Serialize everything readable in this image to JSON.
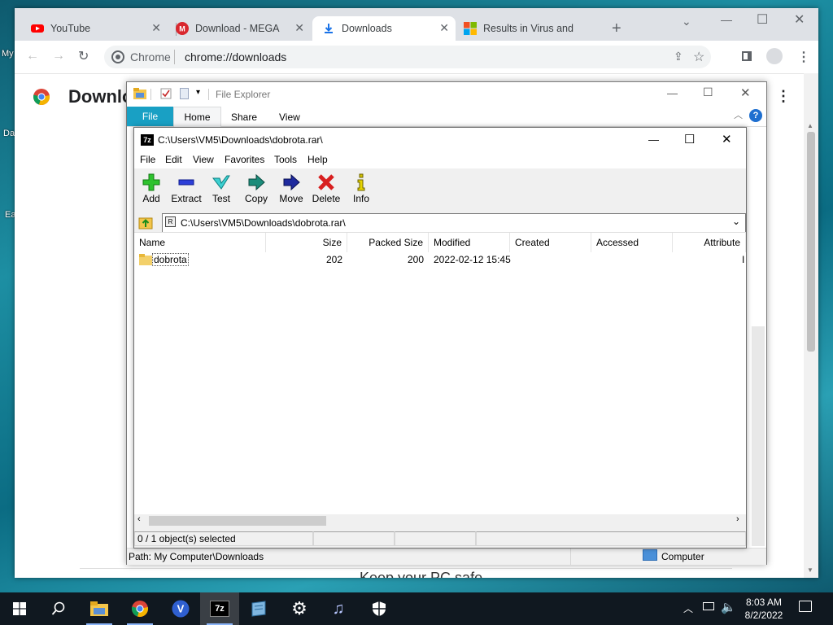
{
  "desktop": {
    "fragments": [
      "My",
      "Da",
      "Ea"
    ]
  },
  "chrome": {
    "tabs": [
      {
        "label": "YouTube",
        "icon": "youtube-icon"
      },
      {
        "label": "Download - MEGA",
        "icon": "mega-icon"
      },
      {
        "label": "Downloads",
        "icon": "download-icon"
      },
      {
        "label": "Results in Virus and",
        "icon": "microsoft-icon"
      }
    ],
    "omnibox": {
      "site": "Chrome",
      "url": "chrome://downloads"
    },
    "page_title": "Downlo",
    "bottom_peek": "Keep your PC safe"
  },
  "explorer": {
    "title": "File Explorer",
    "ribbon_tabs": [
      "File",
      "Home",
      "Share",
      "View"
    ],
    "status_path": "Path: My Computer\\Downloads",
    "status_location": "Computer"
  },
  "sevenzip": {
    "title": "C:\\Users\\VM5\\Downloads\\dobrota.rar\\",
    "menu": [
      "File",
      "Edit",
      "View",
      "Favorites",
      "Tools",
      "Help"
    ],
    "tools": [
      "Add",
      "Extract",
      "Test",
      "Copy",
      "Move",
      "Delete",
      "Info"
    ],
    "address": "C:\\Users\\VM5\\Downloads\\dobrota.rar\\",
    "columns": [
      "Name",
      "Size",
      "Packed Size",
      "Modified",
      "Created",
      "Accessed",
      "Attribute"
    ],
    "rows": [
      {
        "name": "dobrota",
        "size": "202",
        "packed": "200",
        "modified": "2022-02-12 15:45",
        "created": "",
        "accessed": "",
        "attr": "I"
      }
    ],
    "status": "0 / 1 object(s) selected"
  },
  "taskbar": {
    "time": "8:03 AM",
    "date": "8/2/2022"
  },
  "colors": {
    "accent": "#19a0c4",
    "taskbar": "#101820",
    "chrome_tabstrip": "#dee1e6"
  }
}
